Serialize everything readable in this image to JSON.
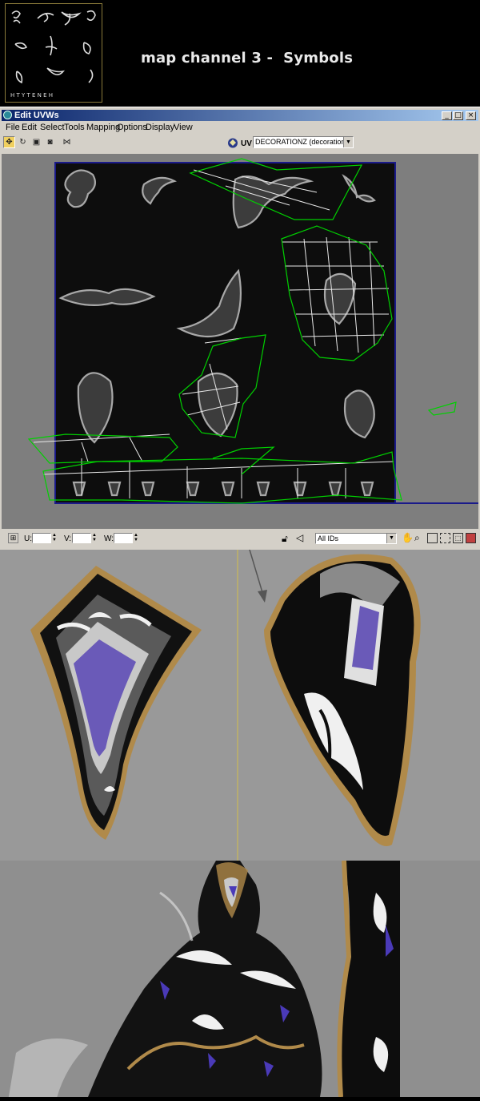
{
  "header": {
    "title": "map channel 3 -  Symbols",
    "thumbnail_glyphs": [
      "Ѧ",
      "Ϯ",
      "Ψ",
      "Ж",
      "Φ",
      "Ϡ",
      "Ѫ",
      "Ω",
      "ϟ"
    ],
    "thumbnail_letters": "ꟷ ꟷ ꟷ ꟷ ꟷ ꟷ ꟷ ꟷ"
  },
  "window": {
    "title": "Edit UVWs",
    "minimize": "_",
    "maximize": "□",
    "close": "×"
  },
  "menu": [
    "File",
    "Edit",
    "Select",
    "Tools",
    "Mapping",
    "Options",
    "Display",
    "View"
  ],
  "toolbar": {
    "uv_label": "UV",
    "map_select_value": "DECORATIONZ (decorationz.bi"
  },
  "statusbar": {
    "u_label": "U:",
    "v_label": "V:",
    "w_label": "W:",
    "ids_select_value": "All IDs"
  },
  "colors": {
    "window_bg": "#d4d0c8",
    "titlebar_start": "#0a246a",
    "uv_wire": "#00d000",
    "texture_frame": "#1a1a8a",
    "gold_trim": "#b08a4a",
    "gem": "#6a5ab8"
  }
}
